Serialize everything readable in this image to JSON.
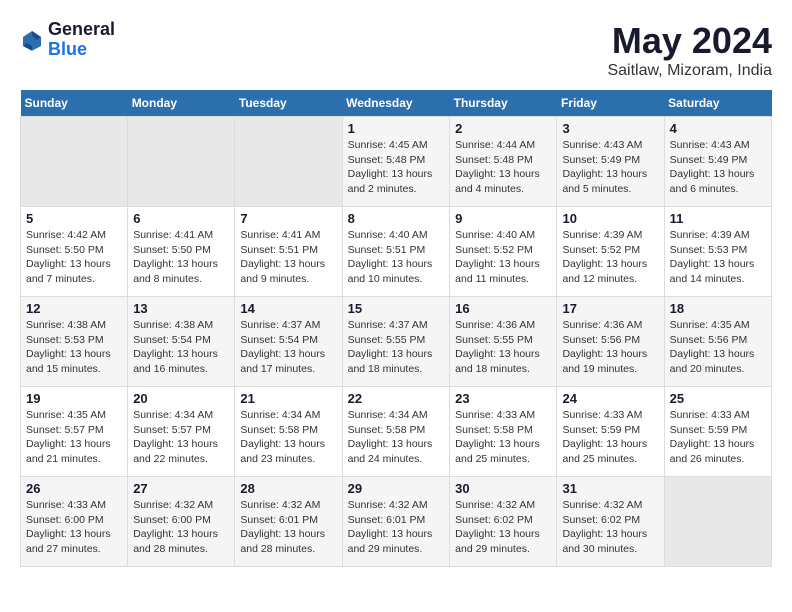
{
  "header": {
    "logo_line1": "General",
    "logo_line2": "Blue",
    "month_year": "May 2024",
    "location": "Saitlaw, Mizoram, India"
  },
  "weekdays": [
    "Sunday",
    "Monday",
    "Tuesday",
    "Wednesday",
    "Thursday",
    "Friday",
    "Saturday"
  ],
  "weeks": [
    [
      {
        "day": "",
        "info": ""
      },
      {
        "day": "",
        "info": ""
      },
      {
        "day": "",
        "info": ""
      },
      {
        "day": "1",
        "info": "Sunrise: 4:45 AM\nSunset: 5:48 PM\nDaylight: 13 hours and 2 minutes."
      },
      {
        "day": "2",
        "info": "Sunrise: 4:44 AM\nSunset: 5:48 PM\nDaylight: 13 hours and 4 minutes."
      },
      {
        "day": "3",
        "info": "Sunrise: 4:43 AM\nSunset: 5:49 PM\nDaylight: 13 hours and 5 minutes."
      },
      {
        "day": "4",
        "info": "Sunrise: 4:43 AM\nSunset: 5:49 PM\nDaylight: 13 hours and 6 minutes."
      }
    ],
    [
      {
        "day": "5",
        "info": "Sunrise: 4:42 AM\nSunset: 5:50 PM\nDaylight: 13 hours and 7 minutes."
      },
      {
        "day": "6",
        "info": "Sunrise: 4:41 AM\nSunset: 5:50 PM\nDaylight: 13 hours and 8 minutes."
      },
      {
        "day": "7",
        "info": "Sunrise: 4:41 AM\nSunset: 5:51 PM\nDaylight: 13 hours and 9 minutes."
      },
      {
        "day": "8",
        "info": "Sunrise: 4:40 AM\nSunset: 5:51 PM\nDaylight: 13 hours and 10 minutes."
      },
      {
        "day": "9",
        "info": "Sunrise: 4:40 AM\nSunset: 5:52 PM\nDaylight: 13 hours and 11 minutes."
      },
      {
        "day": "10",
        "info": "Sunrise: 4:39 AM\nSunset: 5:52 PM\nDaylight: 13 hours and 12 minutes."
      },
      {
        "day": "11",
        "info": "Sunrise: 4:39 AM\nSunset: 5:53 PM\nDaylight: 13 hours and 14 minutes."
      }
    ],
    [
      {
        "day": "12",
        "info": "Sunrise: 4:38 AM\nSunset: 5:53 PM\nDaylight: 13 hours and 15 minutes."
      },
      {
        "day": "13",
        "info": "Sunrise: 4:38 AM\nSunset: 5:54 PM\nDaylight: 13 hours and 16 minutes."
      },
      {
        "day": "14",
        "info": "Sunrise: 4:37 AM\nSunset: 5:54 PM\nDaylight: 13 hours and 17 minutes."
      },
      {
        "day": "15",
        "info": "Sunrise: 4:37 AM\nSunset: 5:55 PM\nDaylight: 13 hours and 18 minutes."
      },
      {
        "day": "16",
        "info": "Sunrise: 4:36 AM\nSunset: 5:55 PM\nDaylight: 13 hours and 18 minutes."
      },
      {
        "day": "17",
        "info": "Sunrise: 4:36 AM\nSunset: 5:56 PM\nDaylight: 13 hours and 19 minutes."
      },
      {
        "day": "18",
        "info": "Sunrise: 4:35 AM\nSunset: 5:56 PM\nDaylight: 13 hours and 20 minutes."
      }
    ],
    [
      {
        "day": "19",
        "info": "Sunrise: 4:35 AM\nSunset: 5:57 PM\nDaylight: 13 hours and 21 minutes."
      },
      {
        "day": "20",
        "info": "Sunrise: 4:34 AM\nSunset: 5:57 PM\nDaylight: 13 hours and 22 minutes."
      },
      {
        "day": "21",
        "info": "Sunrise: 4:34 AM\nSunset: 5:58 PM\nDaylight: 13 hours and 23 minutes."
      },
      {
        "day": "22",
        "info": "Sunrise: 4:34 AM\nSunset: 5:58 PM\nDaylight: 13 hours and 24 minutes."
      },
      {
        "day": "23",
        "info": "Sunrise: 4:33 AM\nSunset: 5:58 PM\nDaylight: 13 hours and 25 minutes."
      },
      {
        "day": "24",
        "info": "Sunrise: 4:33 AM\nSunset: 5:59 PM\nDaylight: 13 hours and 25 minutes."
      },
      {
        "day": "25",
        "info": "Sunrise: 4:33 AM\nSunset: 5:59 PM\nDaylight: 13 hours and 26 minutes."
      }
    ],
    [
      {
        "day": "26",
        "info": "Sunrise: 4:33 AM\nSunset: 6:00 PM\nDaylight: 13 hours and 27 minutes."
      },
      {
        "day": "27",
        "info": "Sunrise: 4:32 AM\nSunset: 6:00 PM\nDaylight: 13 hours and 28 minutes."
      },
      {
        "day": "28",
        "info": "Sunrise: 4:32 AM\nSunset: 6:01 PM\nDaylight: 13 hours and 28 minutes."
      },
      {
        "day": "29",
        "info": "Sunrise: 4:32 AM\nSunset: 6:01 PM\nDaylight: 13 hours and 29 minutes."
      },
      {
        "day": "30",
        "info": "Sunrise: 4:32 AM\nSunset: 6:02 PM\nDaylight: 13 hours and 29 minutes."
      },
      {
        "day": "31",
        "info": "Sunrise: 4:32 AM\nSunset: 6:02 PM\nDaylight: 13 hours and 30 minutes."
      },
      {
        "day": "",
        "info": ""
      }
    ]
  ]
}
